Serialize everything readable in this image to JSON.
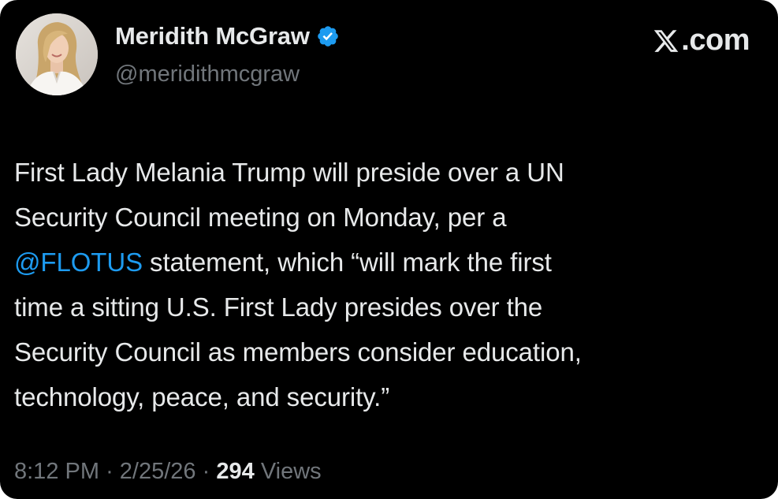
{
  "author": {
    "display_name": "Meridith McGraw",
    "handle": "@meridithmcgraw",
    "verified": true,
    "avatar_icon": "user-avatar-photo"
  },
  "brand": {
    "suffix": ".com",
    "logo_icon": "x-logo-icon"
  },
  "tweet": {
    "lines": [
      [
        {
          "text": "First Lady Melania Trump will preside over a UN"
        }
      ],
      [
        {
          "text": "Security Council meeting on Monday, per a"
        }
      ],
      [
        {
          "text": "@FLOTUS"
        },
        {
          "text": " statement, which “will mark the first"
        }
      ],
      [
        {
          "text": "time a sitting U.S. First Lady presides over the"
        }
      ],
      [
        {
          "text": "Security Council as members consider education,"
        }
      ],
      [
        {
          "text": "technology, peace, and security.”"
        }
      ]
    ]
  },
  "meta": {
    "time": "8:12 PM",
    "separator": "·",
    "date": "2/25/26",
    "views_count": "294",
    "views_label": "Views"
  },
  "colors": {
    "background": "#000000",
    "text_primary": "#e7e9ea",
    "text_secondary": "#71767b",
    "accent_blue": "#1d9bf0"
  }
}
